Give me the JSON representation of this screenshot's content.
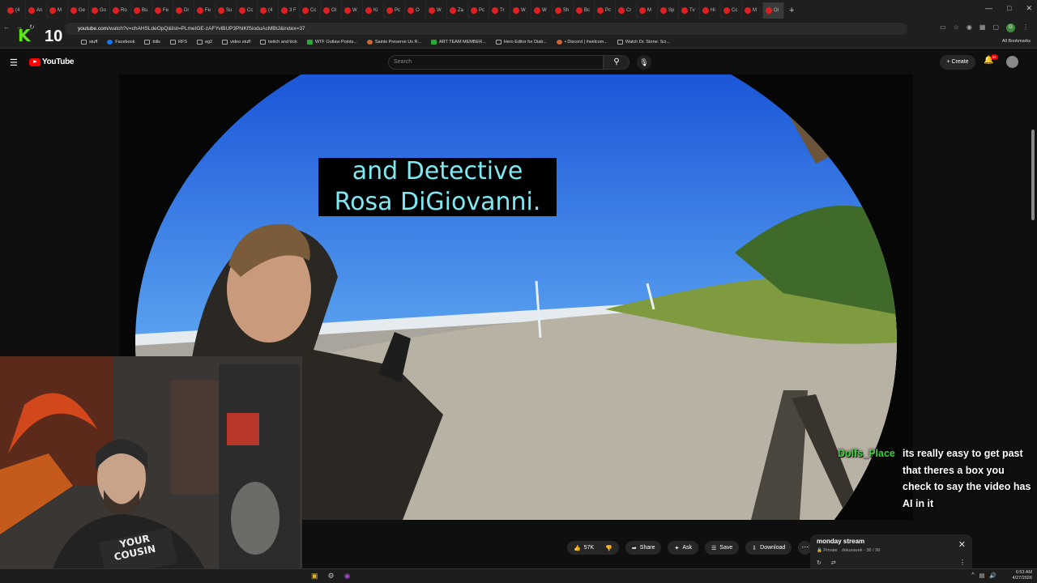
{
  "browser": {
    "tabs": [
      "(4",
      "An",
      "M",
      "Ge",
      "Go",
      "Ro",
      "Bu",
      "Fe",
      "Dr",
      "Fe",
      "Su",
      "Cc",
      "(4",
      "3 F",
      "Cc",
      "Ol",
      "W",
      "Ki",
      "Pc",
      "O",
      "W",
      "Za",
      "Pc",
      "Tr",
      "W",
      "W",
      "Sh",
      "Bc",
      "Pc",
      "Cr",
      "M",
      "Sp",
      "Tv",
      "Hi",
      "Cc",
      "M",
      "Ol"
    ],
    "active_tab_index": 36,
    "url_domain": "youtube.com",
    "url_rest": "/watch?v=chAHSLdeOpQ&list=PLmeIGE-zAFYvlBUP3PhlKfSioduAcMBtJ&index=37",
    "bookmarks": [
      "stuff",
      "Facebook",
      "bills",
      "RFS",
      "eg2",
      "video stuff",
      "twitch and kick",
      "WTF Outlaw Points...",
      "Saints Preserve Us R...",
      "ART TEAM MEMBER...",
      "Hero Editor for Diab...",
      "• Discord | #welcom...",
      "Watch Dr. Stone: Sci..."
    ],
    "all_bookmarks": "All Bookmarks",
    "profile_initial": "G"
  },
  "overlay": {
    "logo_letter": "K",
    "counter": "10"
  },
  "youtube": {
    "logo_text": "YouTube",
    "search_placeholder": "Search",
    "create_label": "Create",
    "notif_badge": "9+"
  },
  "video": {
    "caption_line1": "and Detective",
    "caption_line2": "Rosa DiGiovanni."
  },
  "chat": {
    "username": "Dolfs_Place",
    "message": "its really easy to get past that theres a box you check to say the video has AI in it"
  },
  "actions": {
    "likes": "57K",
    "share": "Share",
    "ask": "Ask",
    "save": "Save",
    "download": "Download"
  },
  "playlist": {
    "title": "monday stream",
    "visibility": "Private",
    "owner": "dekaravek",
    "position": "36 / 38"
  },
  "taskbar": {
    "time": "6:53 AM",
    "date": "4/27/2026"
  }
}
